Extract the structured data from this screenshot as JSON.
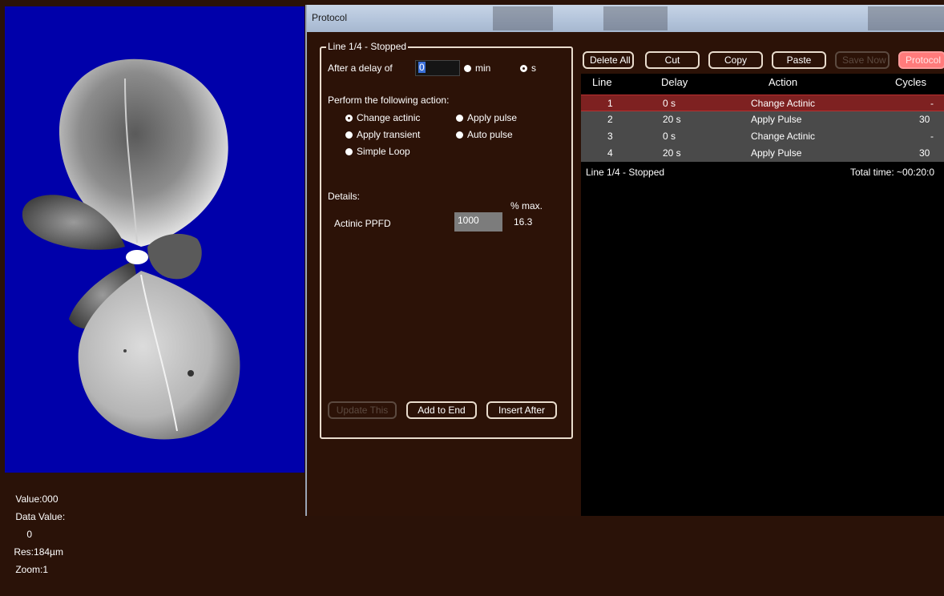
{
  "viewer": {
    "status": {
      "value": "Value:000",
      "data_value_label": "Data Value:",
      "data_value": "0",
      "res": "Res:184µm",
      "zoom": "Zoom:1"
    }
  },
  "window": {
    "title": "Protocol"
  },
  "line_editor": {
    "group_title": "Line 1/4 - Stopped",
    "delay_label": "After a delay of",
    "delay_value": "0",
    "unit_min": "min",
    "unit_s": "s",
    "selected_unit": "s",
    "action_label": "Perform the following action:",
    "actions": [
      {
        "label": "Change actinic",
        "selected": true
      },
      {
        "label": "Apply pulse",
        "selected": false
      },
      {
        "label": "Apply transient",
        "selected": false
      },
      {
        "label": "Auto pulse",
        "selected": false
      },
      {
        "label": "Simple Loop",
        "selected": false
      }
    ],
    "details_label": "Details:",
    "pct_max_label": "% max.",
    "ppfd_label": "Actinic PPFD",
    "ppfd_value": "1000",
    "pct_value": "16.3",
    "update_button": "Update This",
    "add_button": "Add to End",
    "insert_button": "Insert After"
  },
  "toolbar": {
    "delete_all": "Delete All",
    "cut": "Cut",
    "copy": "Copy",
    "paste": "Paste",
    "save_now": "Save Now",
    "protocol": "Protocol"
  },
  "table": {
    "headers": [
      "Line",
      "Delay",
      "Action",
      "Cycles"
    ],
    "rows": [
      {
        "line": "1",
        "delay": "0 s",
        "action": "Change Actinic",
        "cycles": "-",
        "selected": true
      },
      {
        "line": "2",
        "delay": "20 s",
        "action": "Apply Pulse",
        "cycles": "30",
        "selected": false
      },
      {
        "line": "3",
        "delay": "0 s",
        "action": "Change Actinic",
        "cycles": "-",
        "selected": false
      },
      {
        "line": "4",
        "delay": "20 s",
        "action": "Apply Pulse",
        "cycles": "30",
        "selected": false
      }
    ],
    "footer_status": "Line 1/4 - Stopped",
    "total_time": "Total time: ~00:20:0"
  },
  "colors": {
    "viewer_background": "#0000aa",
    "panel_background": "#2c1207",
    "selected_row": "#7e2121",
    "accent_button": "#ff7b7b"
  }
}
